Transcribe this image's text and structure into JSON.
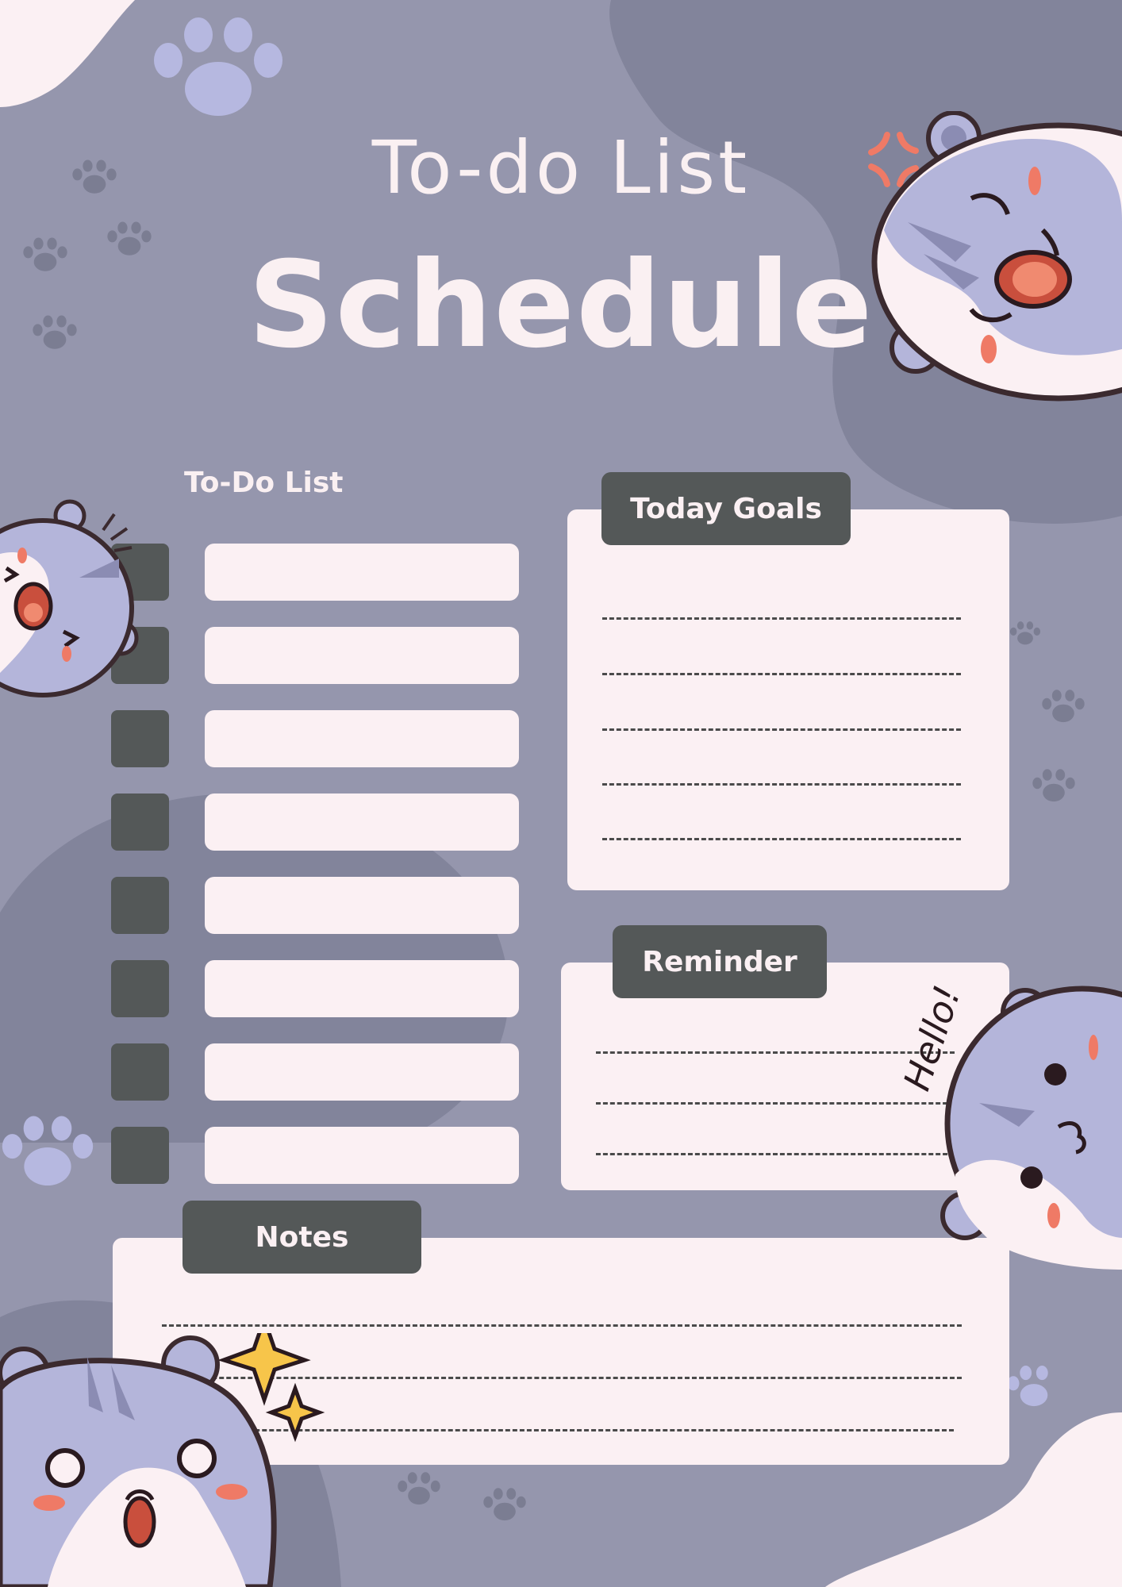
{
  "header": {
    "title_line1": "To-do List",
    "title_line2": "Schedule"
  },
  "todo": {
    "heading": "To-Do List",
    "rows": 8
  },
  "today_goals": {
    "label": "Today Goals",
    "lines": 5
  },
  "reminder": {
    "label": "Reminder",
    "lines": 3
  },
  "notes": {
    "label": "Notes",
    "lines": 3
  },
  "sticker_text": {
    "hello": "Hello!"
  },
  "colors": {
    "background": "#9596ad",
    "shape_dark": "#82849b",
    "panel": "#fbf0f3",
    "tab": "#545858",
    "paw": "#b6b8e0",
    "hamster_fur": "#b4b5da",
    "hamster_white": "#fbf0f3",
    "blush": "#ef7a66",
    "sparkle": "#f7c54a"
  },
  "icons": [
    "paw-print-icon",
    "hamster-icon",
    "sparkle-icon",
    "anger-mark-icon"
  ]
}
